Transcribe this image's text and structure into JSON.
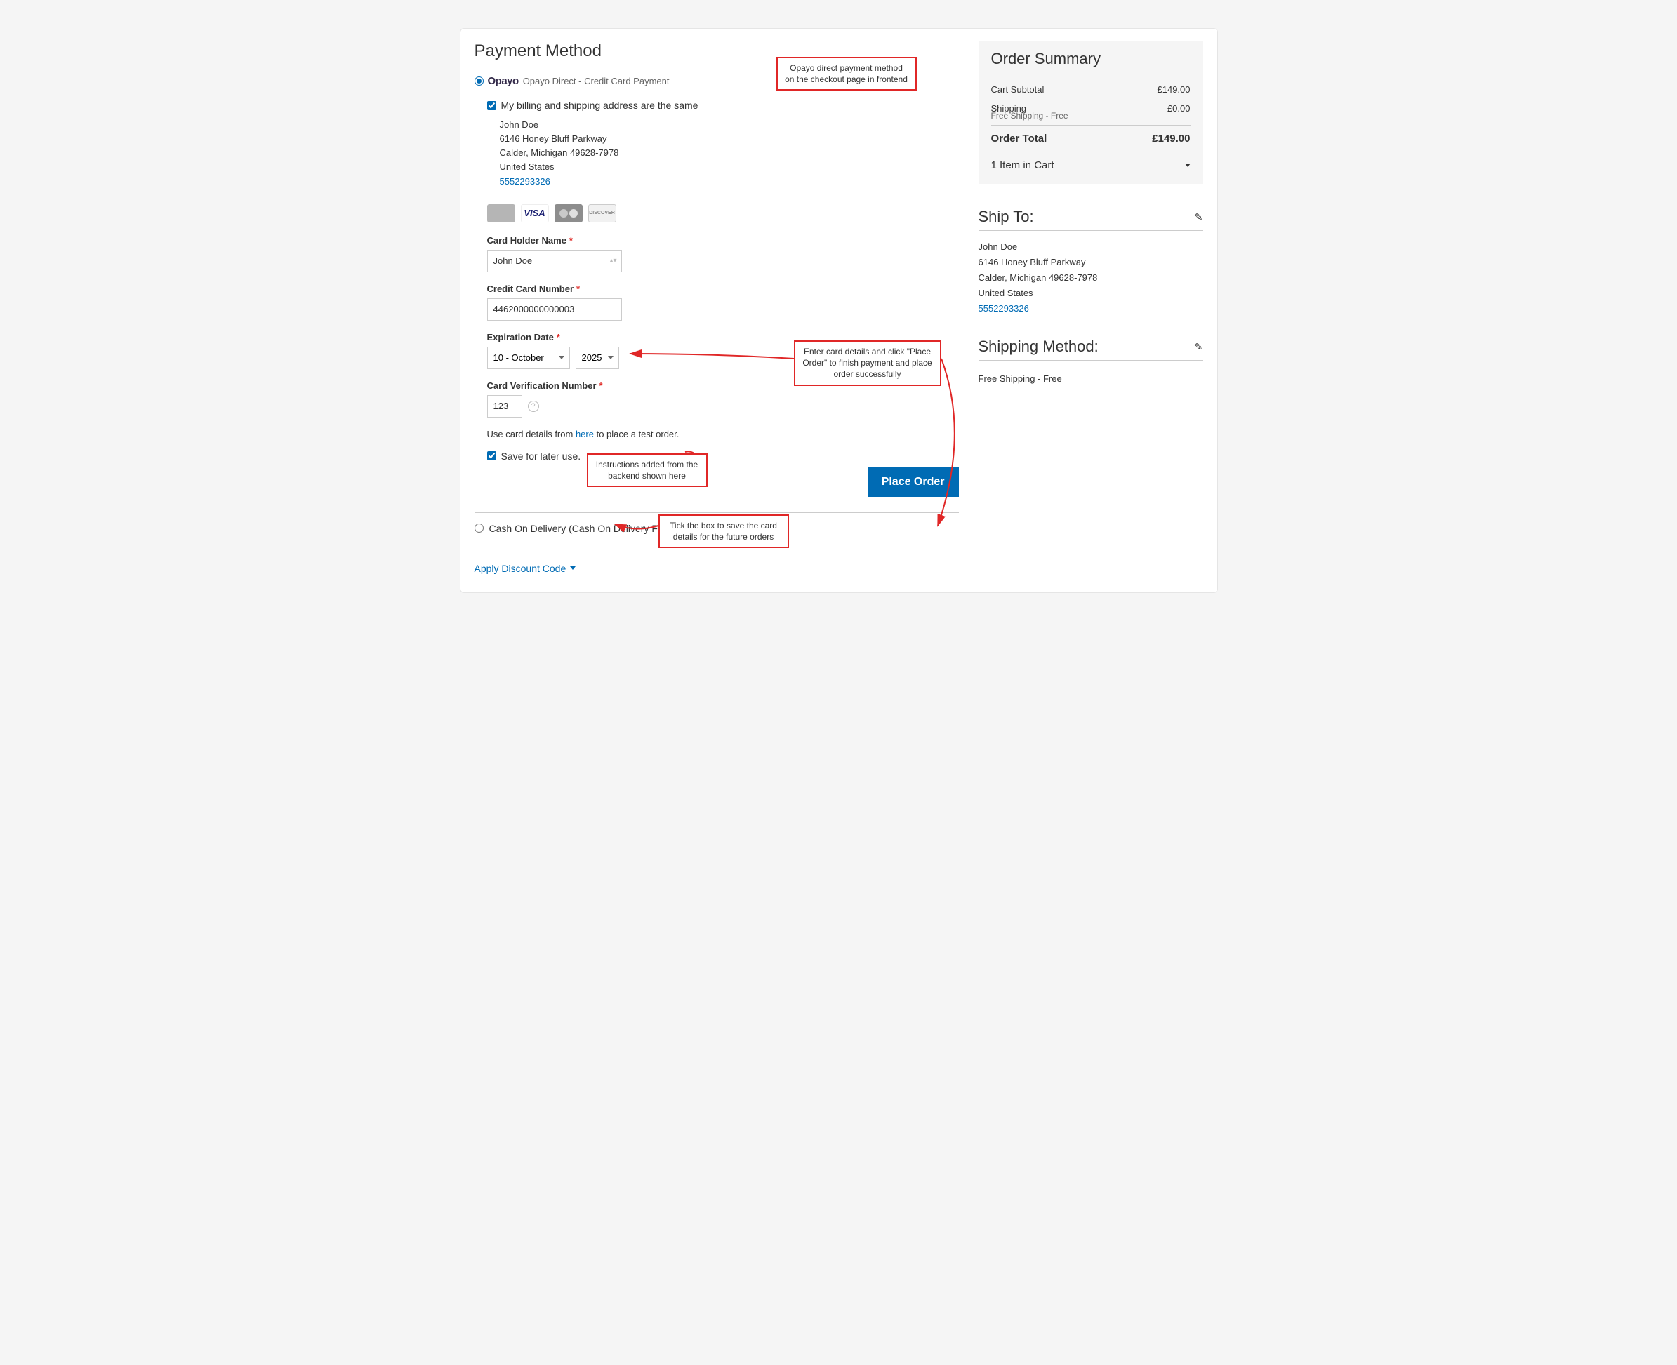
{
  "payment": {
    "title": "Payment Method",
    "opayo_label": "Opayo Direct - Credit Card Payment",
    "billing_same_label": "My billing and shipping address are the same",
    "address": {
      "name": "John Doe",
      "street": "6146 Honey Bluff Parkway",
      "city_state_zip": "Calder, Michigan 49628-7978",
      "country": "United States",
      "phone": "5552293326"
    },
    "card_icons": [
      "amex",
      "visa",
      "mastercard",
      "discover"
    ],
    "fields": {
      "card_holder_label": "Card Holder Name",
      "card_holder_value": "John Doe",
      "cc_number_label": "Credit Card Number",
      "cc_number_value": "4462000000000003",
      "exp_label": "Expiration Date",
      "exp_month": "10 - October",
      "exp_year": "2025",
      "cvv_label": "Card Verification Number",
      "cvv_value": "123"
    },
    "instructions_prefix": "Use card details from ",
    "instructions_link": "here",
    "instructions_suffix": " to place a test order.",
    "save_label": "Save for later use.",
    "place_order_btn": "Place Order",
    "cod_label": "Cash On Delivery (Cash On Delivery Fee: 10.00%)",
    "discount_link": "Apply Discount Code"
  },
  "summary": {
    "title": "Order Summary",
    "subtotal_label": "Cart Subtotal",
    "subtotal_value": "£149.00",
    "shipping_label": "Shipping",
    "shipping_value": "£0.00",
    "shipping_method": "Free Shipping - Free",
    "total_label": "Order Total",
    "total_value": "£149.00",
    "items_label": "1 Item in Cart"
  },
  "ship_to": {
    "title": "Ship To:",
    "name": "John Doe",
    "street": "6146 Honey Bluff Parkway",
    "city_state_zip": "Calder, Michigan 49628-7978",
    "country": "United States",
    "phone": "5552293326"
  },
  "shipping_method": {
    "title": "Shipping Method:",
    "text": "Free Shipping - Free"
  },
  "annotations": {
    "top_callout": "Opayo direct payment method on the checkout page in frontend",
    "card_callout": "Enter card details and click \"Place Order\" to finish payment and place order successfully",
    "instructions_callout": "Instructions added from the backend shown here",
    "save_callout": "Tick the box to save the card details for the future orders"
  },
  "brand": {
    "opayo": "Opayo"
  },
  "card_brands": {
    "visa": "VISA",
    "discover": "DISCOVER"
  }
}
